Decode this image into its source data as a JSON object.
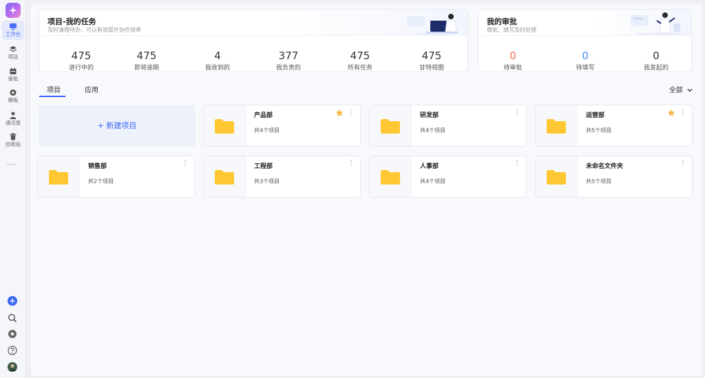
{
  "rail": {
    "items": [
      {
        "label": "工作台"
      },
      {
        "label": "项目"
      },
      {
        "label": "审批"
      },
      {
        "label": "模板"
      },
      {
        "label": "通讯录"
      },
      {
        "label": "回收站"
      }
    ],
    "more": "···"
  },
  "tasks": {
    "title": "项目-我的任务",
    "subtitle": "及时清理待办，可以有效提升协作效率",
    "stats": [
      {
        "value": "475",
        "label": "进行中的"
      },
      {
        "value": "475",
        "label": "即将逾期"
      },
      {
        "value": "4",
        "label": "我收到的"
      },
      {
        "value": "377",
        "label": "我负责的"
      },
      {
        "value": "475",
        "label": "所有任务"
      },
      {
        "value": "475",
        "label": "甘特视图"
      }
    ]
  },
  "approvals": {
    "title": "我的审批",
    "subtitle": "审批、填写及时处理",
    "stats": [
      {
        "value": "0",
        "label": "待审批",
        "color": "#f06e5a"
      },
      {
        "value": "0",
        "label": "待填写",
        "color": "#4a8cf7"
      },
      {
        "value": "0",
        "label": "我发起的",
        "color": "#333333"
      }
    ]
  },
  "tabs": [
    {
      "label": "项目",
      "active": true
    },
    {
      "label": "应用",
      "active": false
    }
  ],
  "filter": {
    "label": "全部"
  },
  "new_project": {
    "label": "+ 新建项目"
  },
  "folders": [
    {
      "name": "产品部",
      "count": "共4个项目",
      "starred": true
    },
    {
      "name": "研发部",
      "count": "共4个项目",
      "starred": false
    },
    {
      "name": "运营部",
      "count": "共5个项目",
      "starred": true
    },
    {
      "name": "销售部",
      "count": "共2个项目",
      "starred": false
    },
    {
      "name": "工程部",
      "count": "共3个项目",
      "starred": false
    },
    {
      "name": "人事部",
      "count": "共4个项目",
      "starred": false
    },
    {
      "name": "未命名文件夹",
      "count": "共5个项目",
      "starred": false
    }
  ],
  "colors": {
    "accent": "#3b66f5",
    "folder": "#ffc832",
    "star": "#f5b94c"
  }
}
